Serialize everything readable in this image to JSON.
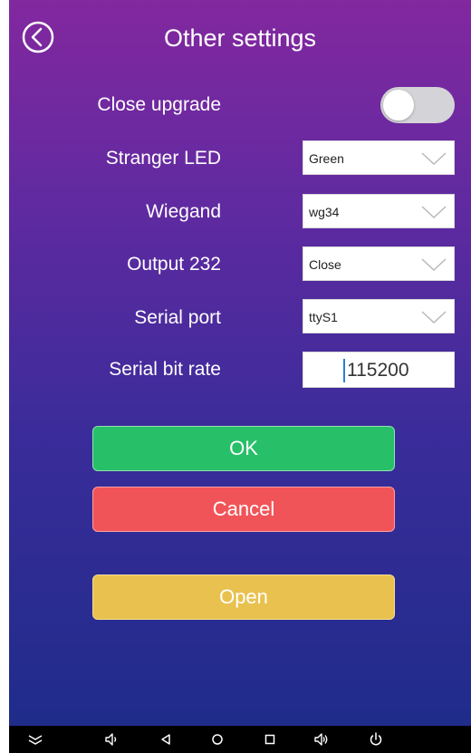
{
  "header": {
    "title": "Other settings",
    "back_icon": "chevron-left-circle-icon"
  },
  "settings": {
    "close_upgrade": {
      "label": "Close upgrade",
      "enabled": false
    },
    "stranger_led": {
      "label": "Stranger LED",
      "value": "Green"
    },
    "wiegand": {
      "label": "Wiegand",
      "value": "wg34"
    },
    "output_232": {
      "label": "Output 232",
      "value": "Close"
    },
    "serial_port": {
      "label": "Serial port",
      "value": "ttyS1"
    },
    "serial_bit_rate": {
      "label": "Serial bit rate",
      "value": "115200"
    }
  },
  "buttons": {
    "ok": "OK",
    "cancel": "Cancel",
    "open": "Open"
  },
  "colors": {
    "ok": "#27c068",
    "cancel": "#f15458",
    "open": "#e9c14f",
    "background_top": "#83289f",
    "background_bottom": "#1f2c8a"
  },
  "navbar": {
    "icons": [
      "hide-keyboard-icon",
      "volume-down-icon",
      "back-triangle-icon",
      "home-circle-icon",
      "recents-square-icon",
      "volume-up-icon",
      "power-icon"
    ]
  }
}
